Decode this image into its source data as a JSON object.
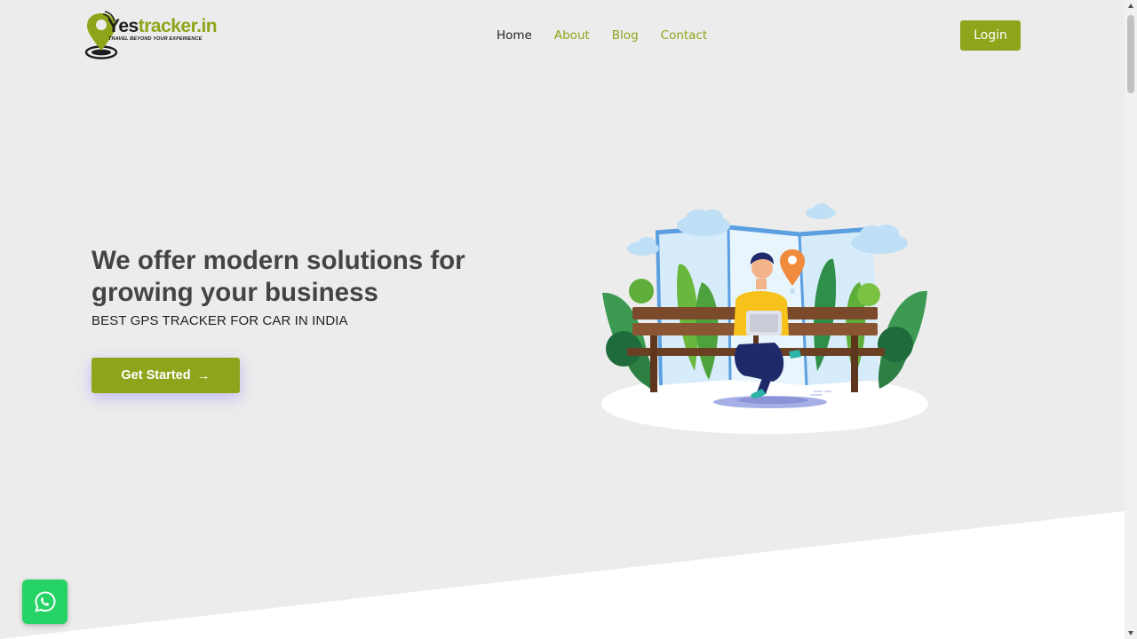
{
  "header": {
    "logo": {
      "part1": "Yes",
      "part2": "tracker.in",
      "tagline": "TRAVEL BEYOND YOUR EXPERIENCE",
      "icon": "map-pin-logo-icon"
    },
    "nav": [
      {
        "label": "Home",
        "active": true
      },
      {
        "label": "About",
        "active": false
      },
      {
        "label": "Blog",
        "active": false
      },
      {
        "label": "Contact",
        "active": false
      }
    ],
    "login_label": "Login"
  },
  "hero": {
    "title": "We offer modern solutions for growing your business",
    "subtitle": "BEST GPS TRACKER FOR CAR IN INDIA",
    "cta_label": "Get Started",
    "cta_icon": "arrow-right-icon",
    "illustration_icon": "man-on-bench-with-laptop-illustration"
  },
  "floating": {
    "whatsapp_icon": "whatsapp-icon"
  },
  "colors": {
    "accent": "#8da51a",
    "background": "#ececec",
    "whatsapp": "#25d366",
    "text_dark": "#444444"
  }
}
